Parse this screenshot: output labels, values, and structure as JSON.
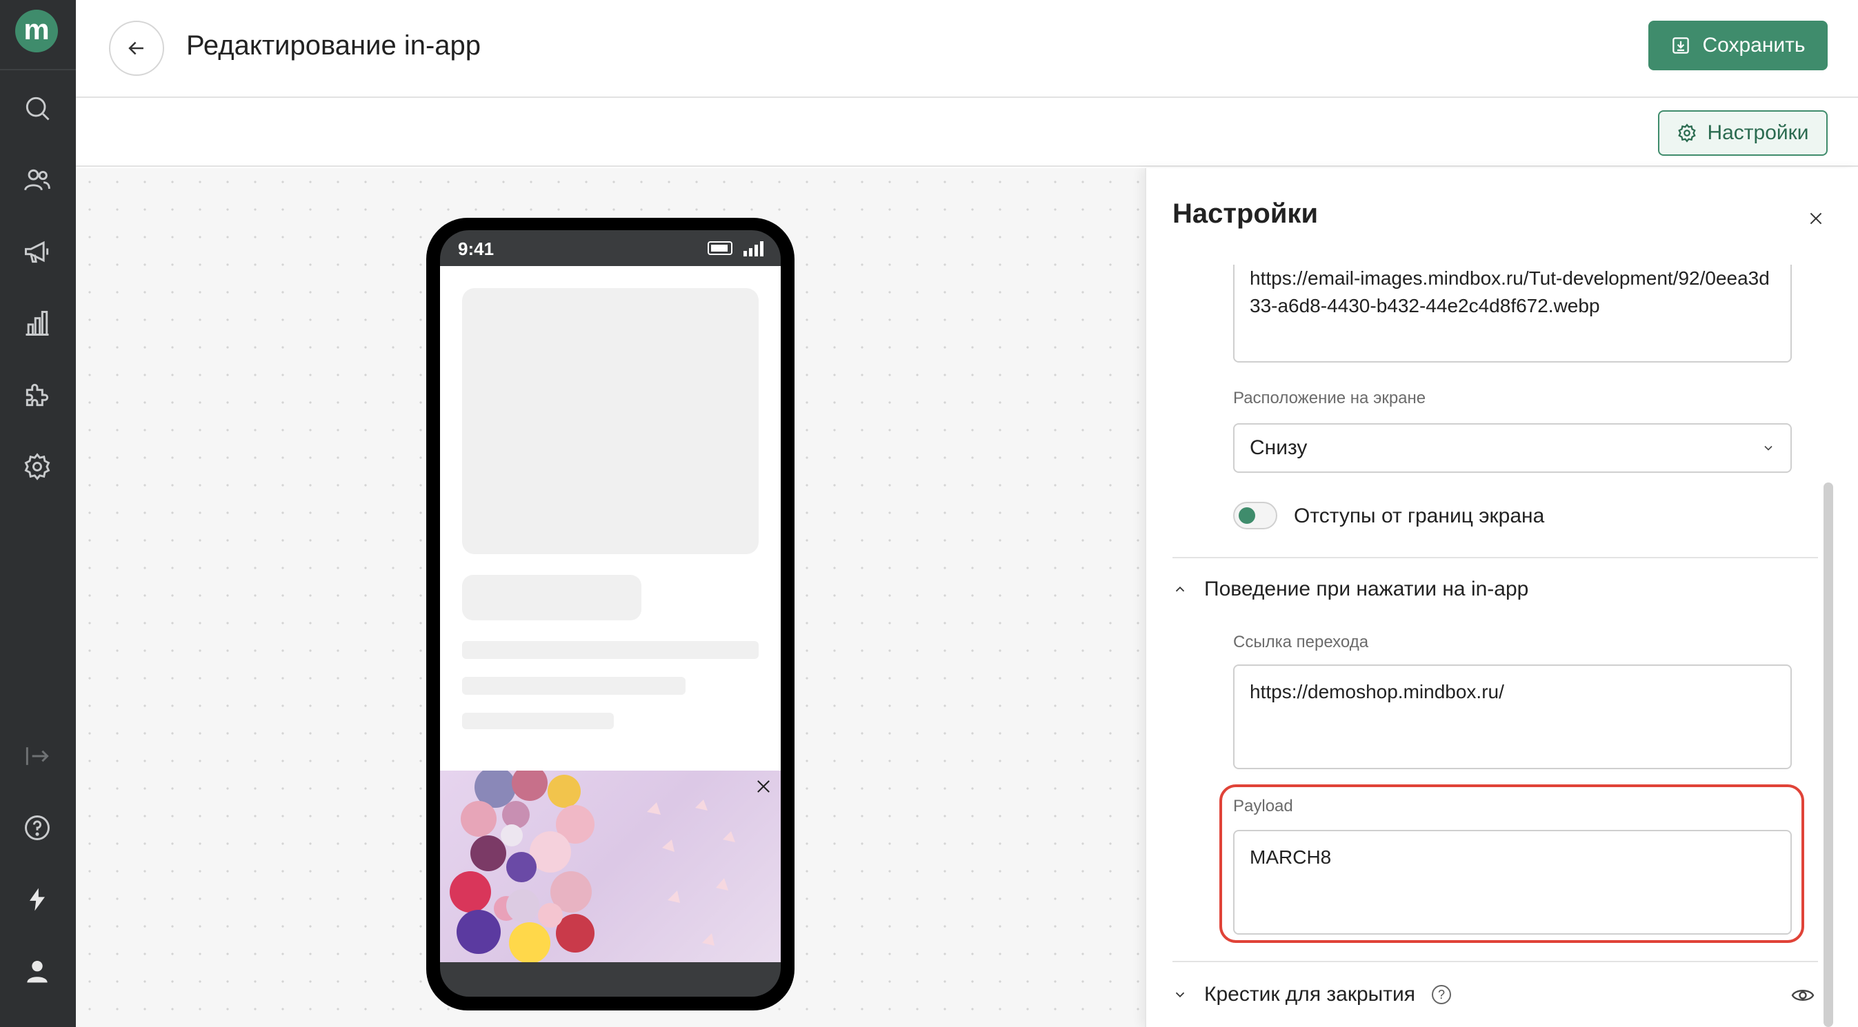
{
  "app": {
    "logo_letter": "m"
  },
  "header": {
    "title": "Редактирование in-app",
    "save_label": "Сохранить"
  },
  "subheader": {
    "settings_label": "Настройки"
  },
  "phone": {
    "time": "9:41"
  },
  "panel": {
    "title": "Настройки",
    "image_url": "https://email-images.mindbox.ru/Tut-development/92/0eea3d33-a6d8-4430-b432-44e2c4d8f672.webp",
    "position_label": "Расположение на экране",
    "position_value": "Снизу",
    "margins_toggle_label": "Отступы от границ экрана",
    "margins_toggle_on": true,
    "click_section_title": "Поведение при нажатии на in-app",
    "link_label": "Ссылка перехода",
    "link_value": "https://demoshop.mindbox.ru/",
    "payload_label": "Payload",
    "payload_value": "MARCH8",
    "close_section_title": "Крестик для закрытия"
  },
  "colors": {
    "brand": "#3f8c6c",
    "rail": "#2e3032",
    "highlight": "#e04338"
  },
  "icons": {
    "rail": [
      "search-icon",
      "users-icon",
      "megaphone-icon",
      "analytics-icon",
      "integrations-icon",
      "settings-icon",
      "expand-icon",
      "help-icon",
      "lightning-icon",
      "user-icon"
    ]
  }
}
